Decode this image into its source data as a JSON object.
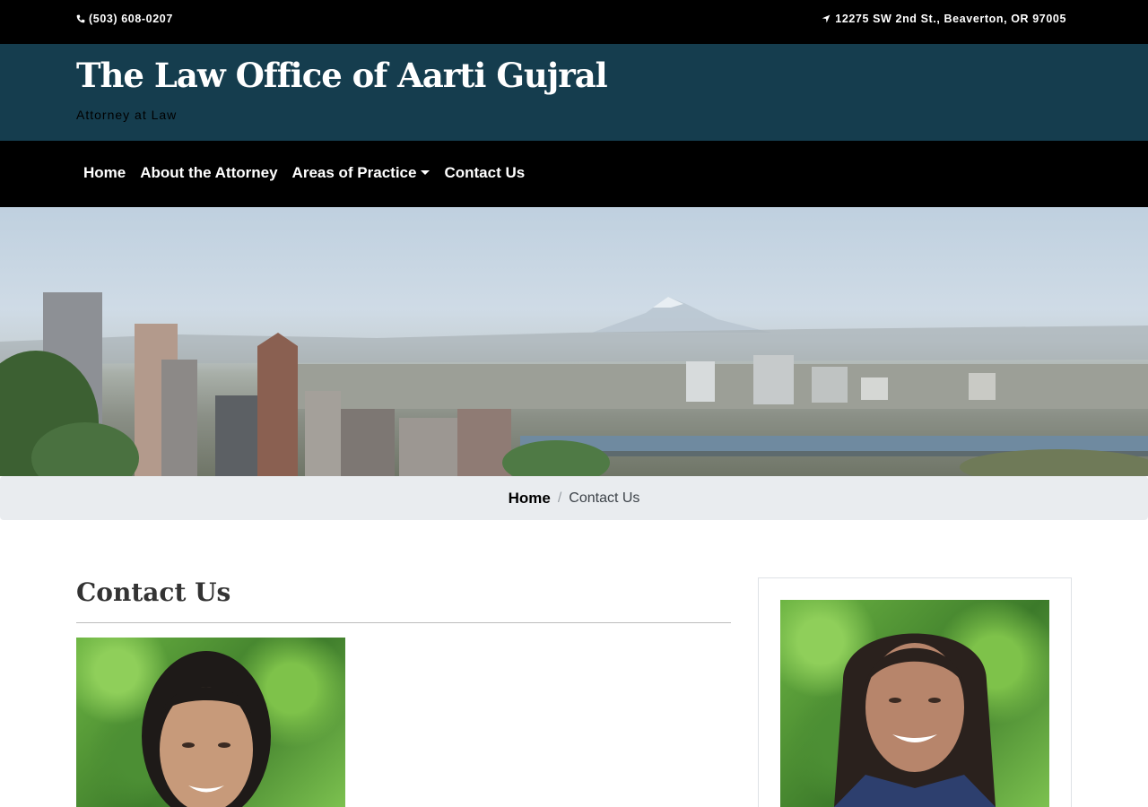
{
  "topbar": {
    "phone": "(503) 608-0207",
    "address": "12275 SW 2nd St., Beaverton, OR 97005",
    "phone_icon": "phone-icon",
    "address_icon": "location-arrow-icon"
  },
  "brand": {
    "title": "The Law Office of Aarti Gujral",
    "tagline": "Attorney at Law",
    "color": "#153d4e"
  },
  "nav": {
    "items": [
      {
        "label": "Home"
      },
      {
        "label": "About the Attorney"
      },
      {
        "label": "Areas of Practice",
        "dropdown": true
      },
      {
        "label": "Contact Us"
      }
    ]
  },
  "breadcrumb": {
    "home": "Home",
    "separator": "/",
    "current": "Contact Us"
  },
  "main": {
    "heading": "Contact Us"
  }
}
